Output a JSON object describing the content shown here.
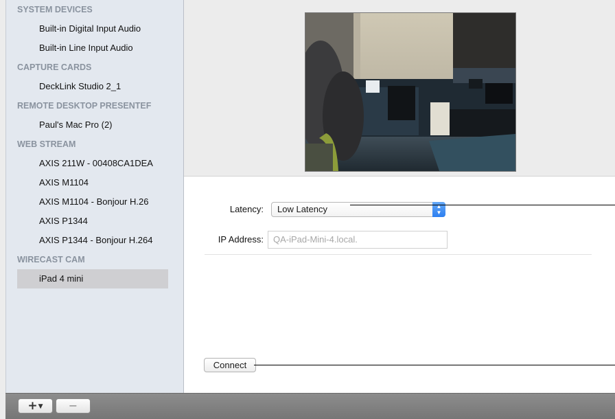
{
  "sidebar": {
    "groups": [
      {
        "title": "SYSTEM DEVICES",
        "items": [
          "Built-in Digital Input Audio",
          "Built-in Line Input Audio"
        ]
      },
      {
        "title": "CAPTURE CARDS",
        "items": [
          "DeckLink Studio 2_1"
        ]
      },
      {
        "title": "REMOTE DESKTOP PRESENTEF",
        "items": [
          "Paul's Mac Pro (2)"
        ]
      },
      {
        "title": "WEB STREAM",
        "items": [
          "AXIS 211W - 00408CA1DEA",
          "AXIS M1104",
          "AXIS M1104 - Bonjour H.26",
          "AXIS P1344",
          "AXIS P1344 - Bonjour H.264"
        ]
      },
      {
        "title": "WIRECAST CAM",
        "items": [
          "iPad 4 mini"
        ]
      }
    ],
    "selected_item": "iPad 4 mini"
  },
  "form": {
    "latency_label": "Latency:",
    "latency_value": "Low Latency",
    "ip_label": "IP Address:",
    "ip_placeholder": "QA-iPad-Mini-4.local.",
    "connect_label": "Connect"
  },
  "toolbar": {
    "add_label": "+",
    "remove_label": "−"
  },
  "icons": {
    "add_menu": "plus-dropdown-icon",
    "remove": "minus-icon",
    "popup_stepper": "up-down-chevron-icon"
  },
  "colors": {
    "sidebar_bg": "#e3e8ef",
    "group_header": "#8a939f",
    "selection": "#cfcfd2",
    "accent": "#2d7ff0"
  }
}
